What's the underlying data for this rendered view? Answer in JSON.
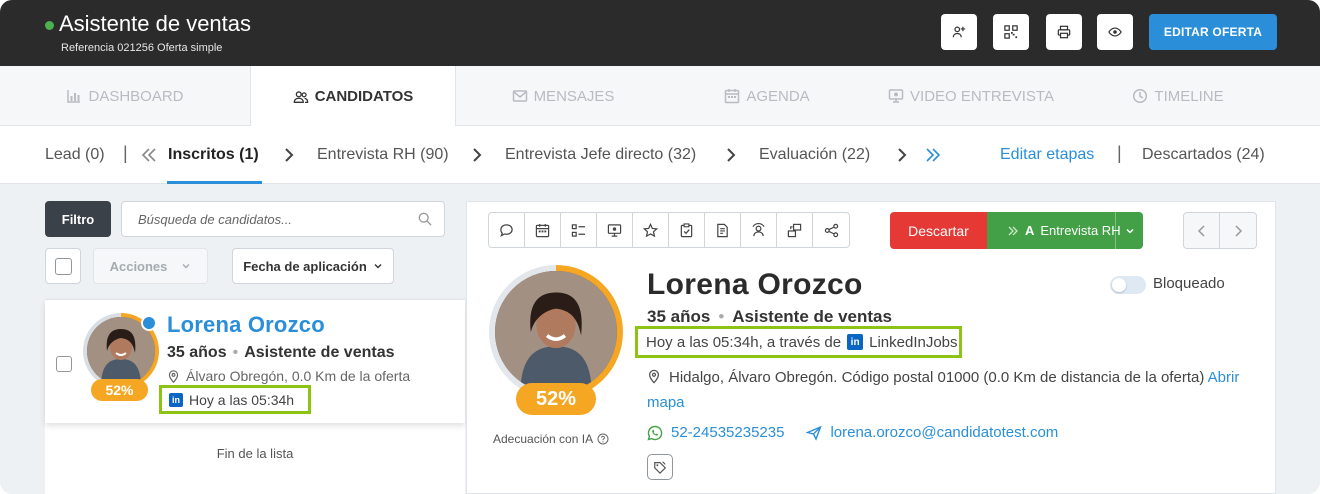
{
  "header": {
    "title": "Asistente de ventas",
    "subtitle": "Referencia 021256 Oferta simple",
    "edit_button": "EDITAR OFERTA",
    "colors": {
      "bar": "#2b2b2b",
      "status": "#4caf50",
      "accent": "#2a8fd8"
    },
    "icons": [
      "add-user-icon",
      "qr-code-icon",
      "print-icon",
      "eye-icon"
    ]
  },
  "tabs": [
    {
      "label": "DASHBOARD",
      "icon": "bar-chart-icon",
      "active": false
    },
    {
      "label": "CANDIDATOS",
      "icon": "users-icon",
      "active": true
    },
    {
      "label": "MENSAJES",
      "icon": "envelope-icon",
      "active": false
    },
    {
      "label": "AGENDA",
      "icon": "calendar-icon",
      "active": false
    },
    {
      "label": "VIDEO ENTREVISTA",
      "icon": "video-icon",
      "active": false
    },
    {
      "label": "TIMELINE",
      "icon": "clock-icon",
      "active": false
    }
  ],
  "stages": {
    "lead": "Lead (0)",
    "inscritos": "Inscritos (1)",
    "entrevista_rh": "Entrevista RH (90)",
    "entrevista_jefe": "Entrevista Jefe directo (32)",
    "evaluacion": "Evaluación (22)",
    "editar": "Editar etapas",
    "descartados": "Descartados (24)"
  },
  "filters": {
    "filter_button": "Filtro",
    "search_placeholder": "Búsqueda de candidatos...",
    "actions_label": "Acciones",
    "sort_label": "Fecha de aplicación"
  },
  "list": {
    "candidate": {
      "name": "Lorena Orozco",
      "age": "35 años",
      "position": "Asistente de ventas",
      "location": "Álvaro Obregón, 0.0 Km de la oferta",
      "applied": "Hoy a las 05:34h",
      "match": "52%",
      "match_value": 52
    },
    "end_text": "Fin de la lista"
  },
  "detail": {
    "discard_button": "Descartar",
    "move_prefix": "A",
    "move_button": "Entrevista RH",
    "name": "Lorena Orozco",
    "blocked_label": "Bloqueado",
    "age": "35 años",
    "position": "Asistente de ventas",
    "applied_via": "Hoy a las 05:34h, a través de",
    "source": "LinkedInJobs",
    "address": "Hidalgo, Álvaro Obregón. Código postal 01000 (0.0 Km de distancia de la oferta)",
    "map_link": "Abrir mapa",
    "phone": "52-24535235235",
    "email": "lorena.orozco@candidatotest.com",
    "match": "52%",
    "match_value": 52,
    "ai_label": "Adecuación con IA",
    "colors": {
      "discard": "#e53935",
      "advance": "#43a047",
      "match": "#f5a623",
      "highlight": "#8dc414"
    },
    "toolbar_icons": [
      "chat-icon",
      "calendar-icon",
      "checklist-icon",
      "video-icon",
      "star-icon",
      "clipboard-icon",
      "document-icon",
      "ai-icon",
      "share-screen-icon",
      "share-icon"
    ]
  }
}
